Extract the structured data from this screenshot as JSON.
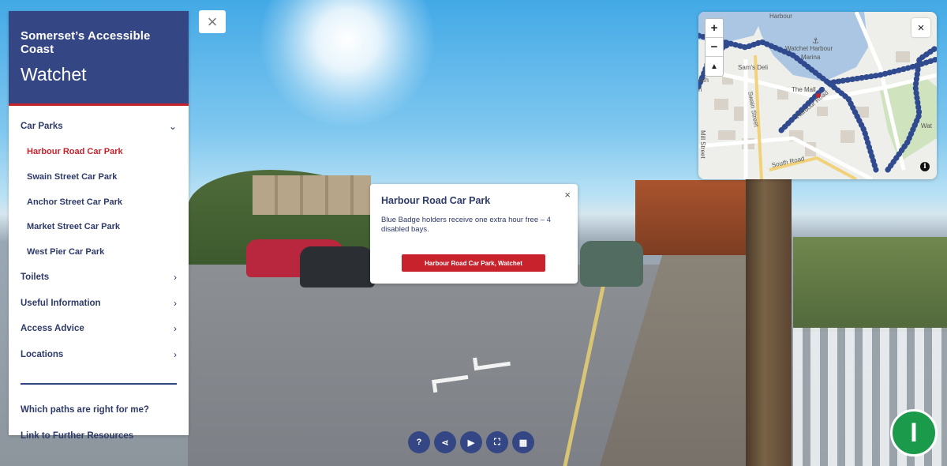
{
  "sidebar": {
    "title": "Somerset’s Accessible Coast",
    "subtitle": "Watchet",
    "sections": [
      {
        "label": "Car Parks",
        "chevron": "chevron-down-icon"
      },
      {
        "label": "Toilets",
        "chevron": "chevron-right-icon"
      },
      {
        "label": "Useful Information",
        "chevron": "chevron-right-icon"
      },
      {
        "label": "Access Advice",
        "chevron": "chevron-right-icon"
      },
      {
        "label": "Locations",
        "chevron": "chevron-right-icon"
      }
    ],
    "car_parks": [
      {
        "label": "Harbour Road Car Park",
        "active": true
      },
      {
        "label": "Swain Street Car Park",
        "active": false
      },
      {
        "label": "Anchor Street Car Park",
        "active": false
      },
      {
        "label": "Market Street Car Park",
        "active": false
      },
      {
        "label": "West Pier Car Park",
        "active": false
      }
    ],
    "links": [
      "Which paths are right for me?",
      "Link to Further Resources"
    ]
  },
  "popup": {
    "title": "Harbour Road Car Park",
    "text": "Blue Badge holders receive one extra hour free – 4 disabled bays.",
    "button": "Harbour Road Car Park, Watchet",
    "close": "×"
  },
  "map": {
    "zoom_in": "+",
    "zoom_out": "−",
    "compass": "▲",
    "close": "×",
    "info": "i",
    "labels": {
      "harbour": "Harbour",
      "marina_1": "Watchet Harbour",
      "marina_2": "Marina",
      "deli": "Sam's Deli",
      "the_mall": "The Mall",
      "swain_street": "Swain Street",
      "harbour_road": "Harbour Road",
      "south_road": "South Road",
      "partial_left_1": "ush",
      "partial_left_2": "n",
      "partial_right": "Wat",
      "mill_street": "Mill Street"
    }
  },
  "top_close": "×",
  "toolbar": [
    {
      "icon": "help-icon",
      "glyph": "?"
    },
    {
      "icon": "share-icon",
      "glyph": "⋖"
    },
    {
      "icon": "play-icon",
      "glyph": "▶"
    },
    {
      "icon": "fullscreen-icon",
      "glyph": "⛶"
    },
    {
      "icon": "map-icon",
      "glyph": "▦"
    }
  ],
  "info_button": "I",
  "colors": {
    "navy": "#354685",
    "red": "#c8232c",
    "green": "#1c9a4c",
    "route": "#2f4a8e"
  }
}
